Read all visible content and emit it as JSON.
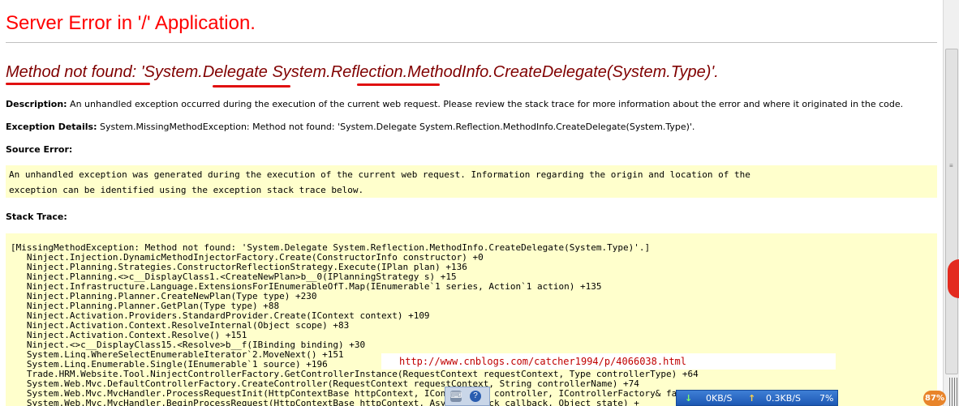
{
  "page": {
    "title": "Server Error in '/' Application.",
    "error_heading": "Method not found: 'System.Delegate System.Reflection.MethodInfo.CreateDelegate(System.Type)'.",
    "description_label": "Description:",
    "description_text": "An unhandled exception occurred during the execution of the current web request. Please review the stack trace for more information about the error and where it originated in the code.",
    "exception_label": "Exception Details:",
    "exception_text": "System.MissingMethodException: Method not found: 'System.Delegate System.Reflection.MethodInfo.CreateDelegate(System.Type)'.",
    "source_label": "Source Error:",
    "source_text": "An unhandled exception was generated during the execution of the current web request. Information regarding the origin and location of the\nexception can be identified using the exception stack trace below.",
    "stack_label": "Stack Trace:",
    "stack_text": "[MissingMethodException: Method not found: 'System.Delegate System.Reflection.MethodInfo.CreateDelegate(System.Type)'.]\n   Ninject.Injection.DynamicMethodInjectorFactory.Create(ConstructorInfo constructor) +0\n   Ninject.Planning.Strategies.ConstructorReflectionStrategy.Execute(IPlan plan) +136\n   Ninject.Planning.<>c__DisplayClass1.<CreateNewPlan>b__0(IPlanningStrategy s) +15\n   Ninject.Infrastructure.Language.ExtensionsForIEnumerableOfT.Map(IEnumerable`1 series, Action`1 action) +135\n   Ninject.Planning.Planner.CreateNewPlan(Type type) +230\n   Ninject.Planning.Planner.GetPlan(Type type) +88\n   Ninject.Activation.Providers.StandardProvider.Create(IContext context) +109\n   Ninject.Activation.Context.ResolveInternal(Object scope) +83\n   Ninject.Activation.Context.Resolve() +151\n   Ninject.<>c__DisplayClass15.<Resolve>b__f(IBinding binding) +30\n   System.Linq.WhereSelectEnumerableIterator`2.MoveNext() +151\n   System.Linq.Enumerable.Single(IEnumerable`1 source) +196\n   Trade.HRM.Website.Tool.NinjectControllerFactory.GetControllerInstance(RequestContext requestContext, Type controllerType) +64\n   System.Web.Mvc.DefaultControllerFactory.CreateController(RequestContext requestContext, String controllerName) +74\n   System.Web.Mvc.MvcHandler.ProcessRequestInit(HttpContextBase httpContext, IController& controller, IControllerFactory& factory) +232\n   System.Web.Mvc.MvcHandler.BeginProcessRequest(HttpContextBase httpContext, AsyncCallback callback, Object state) +"
  },
  "watermark": "http://www.cnblogs.com/catcher1994/p/4066038.html",
  "netmeter": {
    "down_arrow": "↓",
    "down_speed": "0KB/S",
    "up_arrow": "↑",
    "up_speed": "0.3KB/S",
    "cpu": "7%"
  },
  "badge": "87%",
  "colors": {
    "title": "#ff0000",
    "heading": "#800000",
    "code_bg": "#ffffcc",
    "underline": "#e01010"
  }
}
